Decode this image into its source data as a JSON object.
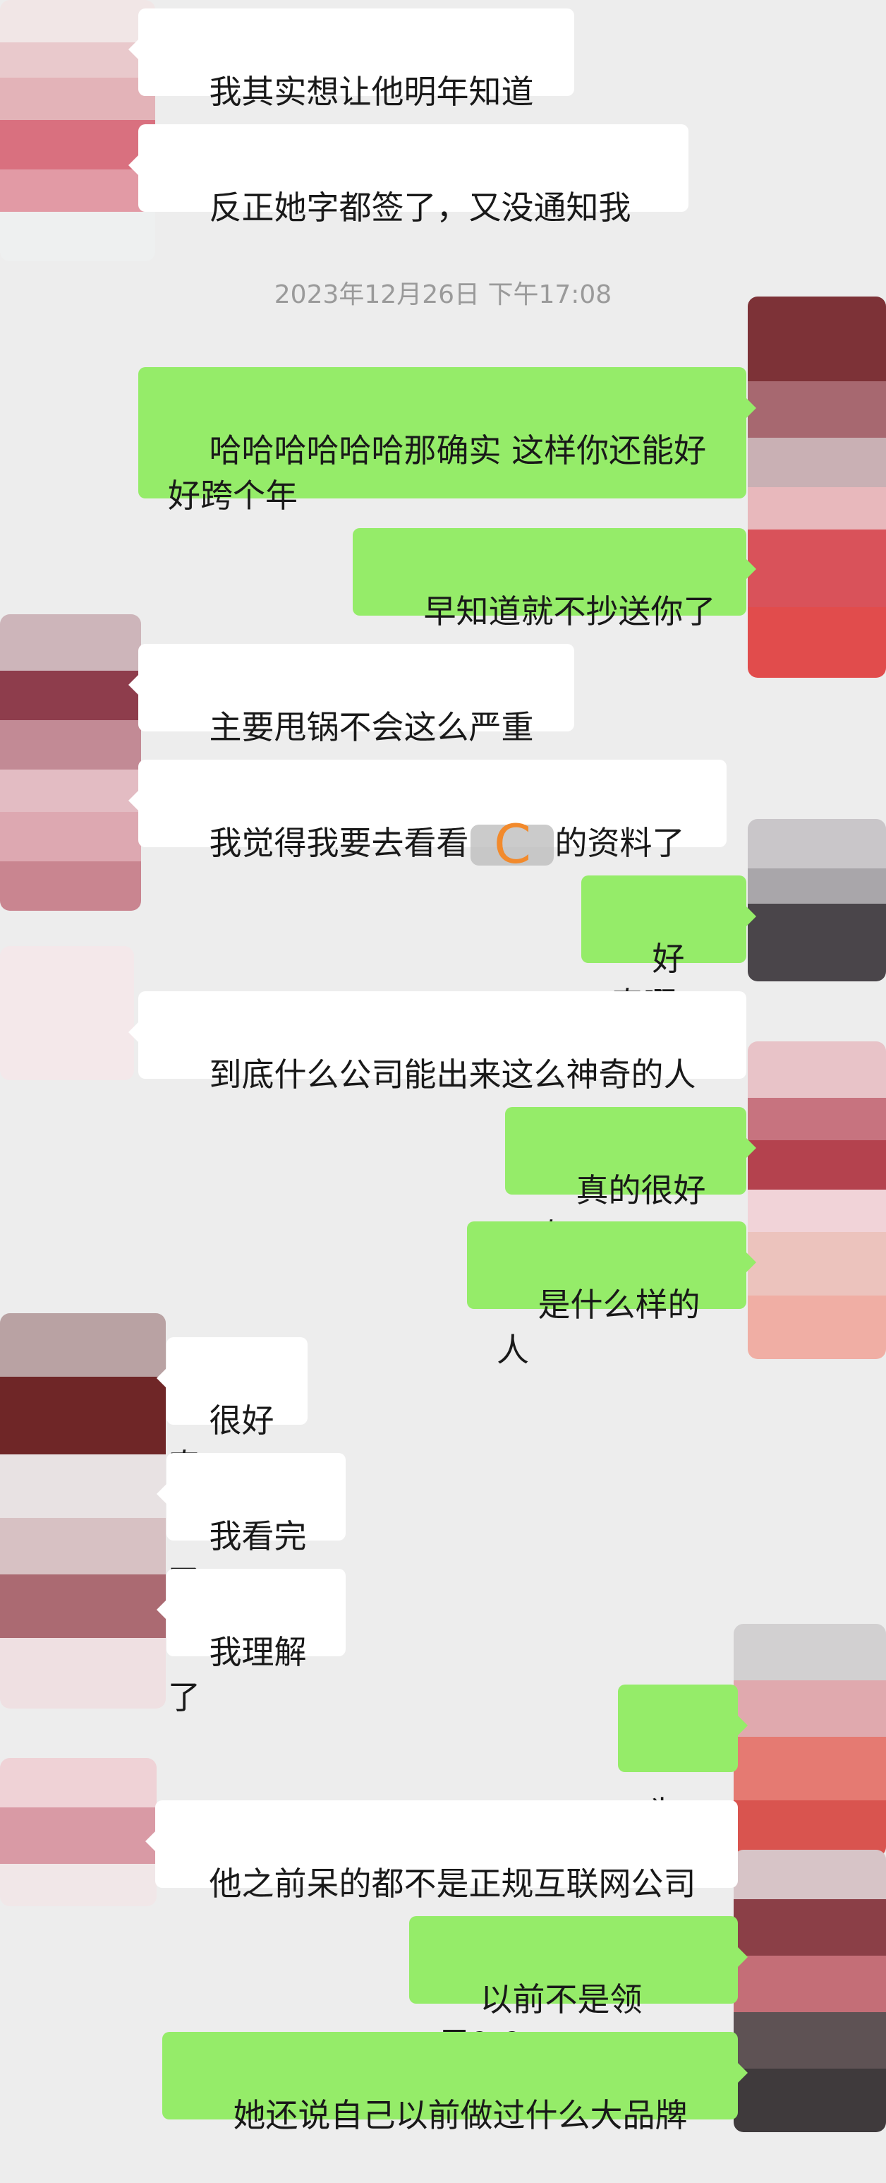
{
  "chat": {
    "timestamp": "2023年12月26日 下午17:08",
    "messages": [
      {
        "side": "left",
        "text": "我其实想让他明年知道"
      },
      {
        "side": "left",
        "text": "反正她字都签了，又没通知我"
      },
      {
        "side": "right",
        "text": "哈哈哈哈哈哈那确实 这样你还能好好跨个年"
      },
      {
        "side": "right",
        "text": "早知道就不抄送你了"
      },
      {
        "side": "left",
        "text": "主要甩锅不会这么严重"
      },
      {
        "side": "left",
        "text_before": "我觉得我要去看看",
        "redacted_mark": "C",
        "text_after": "的资料了"
      },
      {
        "side": "right",
        "text": "好奇啊"
      },
      {
        "side": "left",
        "text": "到底什么公司能出来这么神奇的人"
      },
      {
        "side": "right",
        "text": "真的很好奇"
      },
      {
        "side": "right",
        "text": "是什么样的人"
      },
      {
        "side": "left",
        "text": "很好奇"
      },
      {
        "side": "left",
        "text": "我看完了"
      },
      {
        "side": "left",
        "text": "我理解了"
      },
      {
        "side": "right",
        "text": "为啥"
      },
      {
        "side": "left",
        "text": "他之前呆的都不是正规互联网公司"
      },
      {
        "side": "right",
        "text": "以前不是领导？？"
      },
      {
        "side": "right",
        "text": "她还说自己以前做过什么大品牌"
      }
    ]
  },
  "colors": {
    "background": "#ededed",
    "incoming_bubble": "#ffffff",
    "outgoing_bubble": "#95ec69",
    "text": "#191919",
    "timestamp": "#9a9a9a",
    "redaction_letter": "#f28a2c"
  }
}
